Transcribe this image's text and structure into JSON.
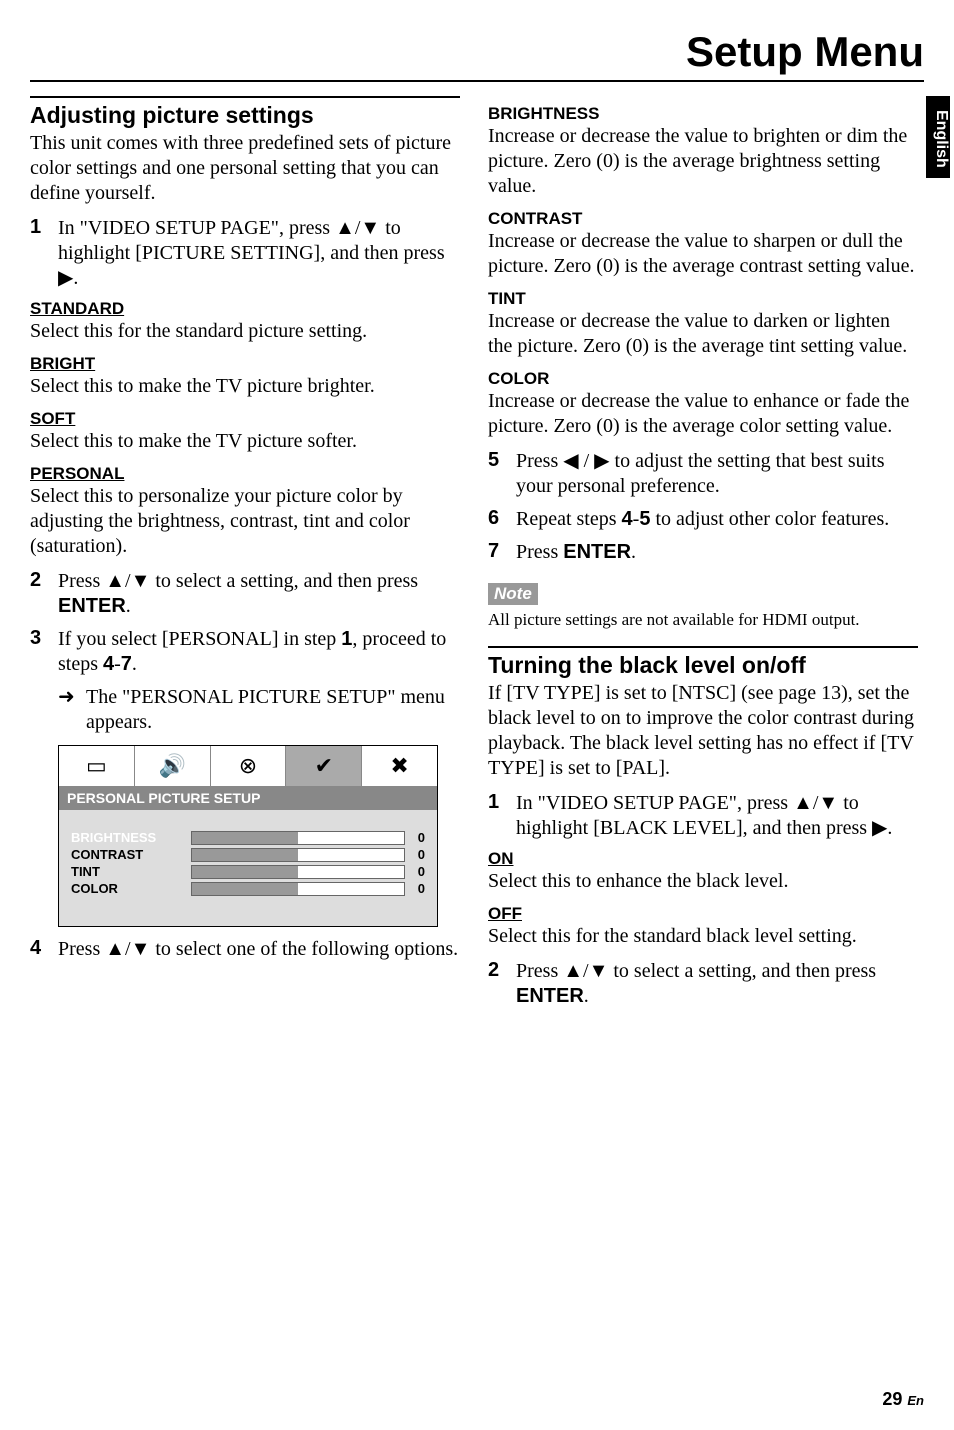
{
  "page_title": "Setup Menu",
  "side_tab": "English",
  "page_number": "29",
  "page_suffix": "En",
  "left": {
    "section1": {
      "heading": "Adjusting picture settings",
      "intro": "This unit comes with three predefined sets of picture color settings and one personal setting that you can define yourself.",
      "step1": "In \"VIDEO SETUP PAGE\", press ▲/▼ to highlight [PICTURE SETTING], and then press ▶.",
      "terms": {
        "standard": {
          "title": "STANDARD",
          "desc": "Select this for the standard picture setting."
        },
        "bright": {
          "title": "BRIGHT",
          "desc": "Select this to make the TV picture brighter."
        },
        "soft": {
          "title": "SOFT",
          "desc": "Select this to make the TV picture softer."
        },
        "personal": {
          "title": "PERSONAL",
          "desc": "Select this to personalize your picture color by adjusting the brightness, contrast, tint and color (saturation)."
        }
      },
      "step2": {
        "a": "Press ▲/▼ to select a setting, and then press ",
        "b": "ENTER",
        "c": "."
      },
      "step3": {
        "a": "If you select [PERSONAL] in step ",
        "b": "1",
        "c": ", proceed to steps ",
        "d": "4",
        "e": "-",
        "f": "7",
        "g": "."
      },
      "step3_sub": "The \"PERSONAL PICTURE SETUP\" menu appears.",
      "menu": {
        "header": "PERSONAL PICTURE SETUP",
        "rows": [
          {
            "label": "BRIGHTNESS",
            "value": "0"
          },
          {
            "label": "CONTRAST",
            "value": "0"
          },
          {
            "label": "TINT",
            "value": "0"
          },
          {
            "label": "COLOR",
            "value": "0"
          }
        ],
        "icons": [
          "▭",
          "🔊",
          "⊗",
          "✔",
          "✖"
        ]
      },
      "step4": "Press ▲/▼ to select one of the following options."
    }
  },
  "right": {
    "terms": {
      "brightness": {
        "title": "BRIGHTNESS",
        "desc": "Increase or decrease the value to brighten or dim the picture. Zero (0) is the average brightness setting value."
      },
      "contrast": {
        "title": "CONTRAST",
        "desc": "Increase or decrease the value to sharpen or dull the picture. Zero (0) is the average contrast setting value."
      },
      "tint": {
        "title": "TINT",
        "desc": "Increase or decrease the value to darken or lighten the picture. Zero (0) is the average tint setting value."
      },
      "color": {
        "title": "COLOR",
        "desc": "Increase or decrease the value to enhance or fade the picture. Zero (0) is the average color setting value."
      }
    },
    "step5": "Press ◀ / ▶ to adjust the setting that best suits your personal preference.",
    "step6": {
      "a": "Repeat steps ",
      "b": "4",
      "c": "-",
      "d": "5",
      "e": " to adjust other color features."
    },
    "step7": {
      "a": "Press ",
      "b": "ENTER",
      "c": "."
    },
    "note_label": "Note",
    "note_text": "All picture settings are not available for HDMI output.",
    "section2": {
      "heading": "Turning the black level on/off",
      "intro": "If [TV TYPE] is set to [NTSC] (see page 13), set the black level to on to improve the color contrast during playback. The black level setting has no effect if [TV TYPE] is set to [PAL].",
      "step1": "In \"VIDEO SETUP PAGE\", press ▲/▼ to highlight [BLACK LEVEL], and then press ▶.",
      "on": {
        "title": "ON",
        "desc": "Select this to enhance the black level."
      },
      "off": {
        "title": "OFF",
        "desc": "Select this for the standard black level setting."
      },
      "step2": {
        "a": "Press ▲/▼ to select a setting, and then press ",
        "b": "ENTER",
        "c": "."
      }
    }
  }
}
